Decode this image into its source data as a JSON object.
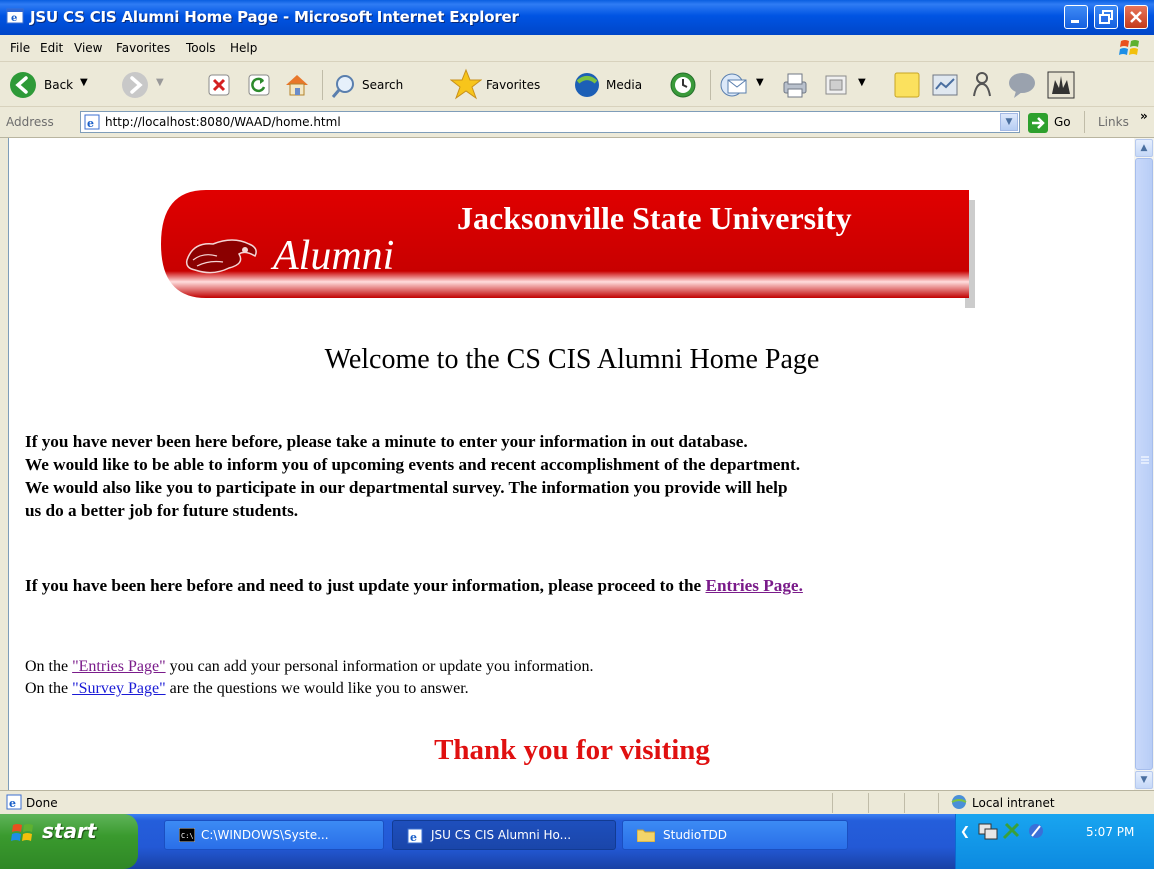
{
  "window": {
    "title": "JSU CS CIS Alumni Home Page - Microsoft Internet Explorer"
  },
  "menu": {
    "items": [
      "File",
      "Edit",
      "View",
      "Favorites",
      "Tools",
      "Help"
    ]
  },
  "toolbar": {
    "back_label": "Back",
    "search_label": "Search",
    "favorites_label": "Favorites",
    "media_label": "Media"
  },
  "address": {
    "label": "Address",
    "url": "http://localhost:8080/WAAD/home.html",
    "go_label": "Go",
    "links_label": "Links"
  },
  "page": {
    "banner_alumni": "Alumni",
    "banner_university": "Jacksonville State University",
    "heading": "Welcome to the CS CIS Alumni Home Page",
    "para1_lines": [
      "If you have never been here before, please take a minute to enter your information in out database.",
      "We would like to be able to inform you of upcoming events and recent accomplishment of the department.",
      "We would also like you to participate in our departmental survey. The information you provide will help",
      "us do a better job for future students."
    ],
    "para2_text": "If you have been here before and need to just update your information, please proceed to the",
    "para2_link": "Entries Page.",
    "line3_prefix": "On the",
    "line3_link": "\"Entries Page\"",
    "line3_suffix": "you can add your personal information or update you information.",
    "line4_prefix": "On the",
    "line4_link": "\"Survey Page\"",
    "line4_suffix": "are the questions we would like you to answer.",
    "thanks": "Thank you for visiting"
  },
  "status": {
    "text": "Done",
    "zone": "Local intranet"
  },
  "taskbar": {
    "start_label": "start",
    "tasks": [
      "C:\\WINDOWS\\Syste...",
      "JSU CS CIS Alumni Ho...",
      "StudioTDD"
    ],
    "clock": "5:07 PM"
  },
  "colors": {
    "banner_red": "#d40000",
    "thanks_red": "#e01010",
    "visited_link": "#7a1b8a",
    "unvisited_link": "#1a1ad6"
  }
}
